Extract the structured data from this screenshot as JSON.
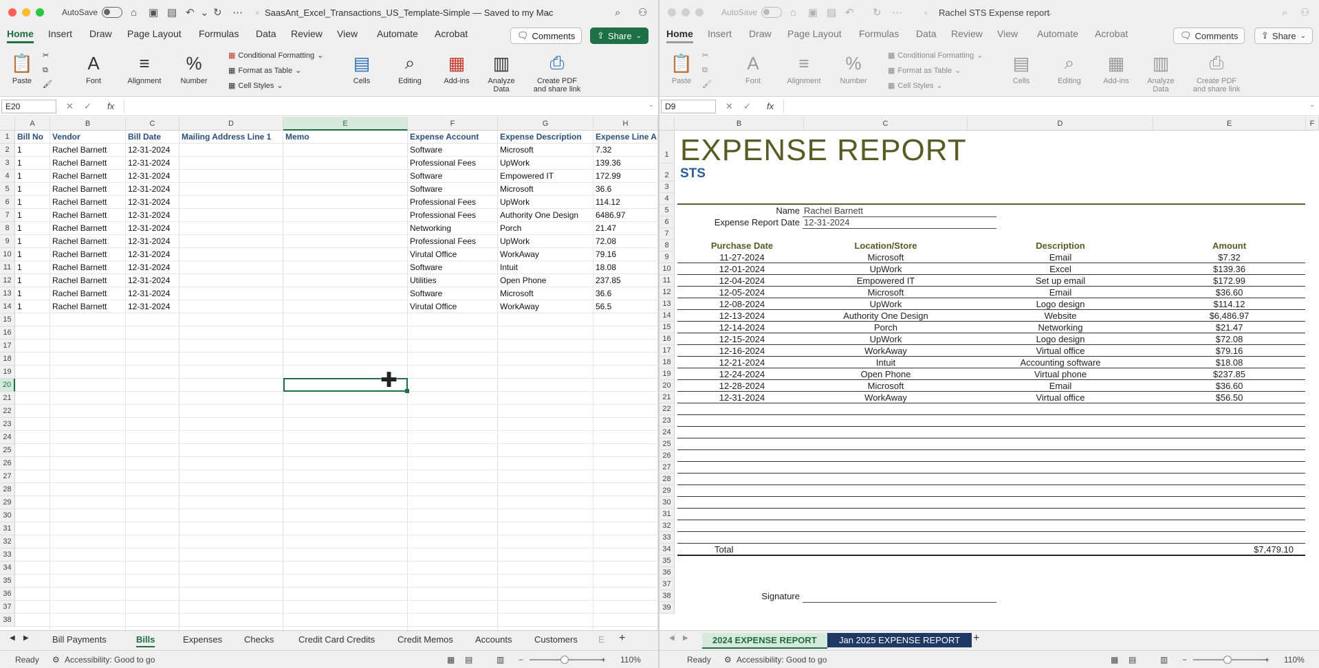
{
  "left": {
    "autosave": "AutoSave",
    "title": "SaasAnt_Excel_Transactions_US_Template-Simple — Saved to my Mac",
    "menu": [
      "Home",
      "Insert",
      "Draw",
      "Page Layout",
      "Formulas",
      "Data",
      "Review",
      "View",
      "Automate",
      "Acrobat"
    ],
    "comments": "Comments",
    "share": "Share",
    "ribbon": {
      "paste": "Paste",
      "font": "Font",
      "alignment": "Alignment",
      "number": "Number",
      "cond_format": "Conditional Formatting",
      "format_table": "Format as Table",
      "cell_styles": "Cell Styles",
      "cells": "Cells",
      "editing": "Editing",
      "addins": "Add-ins",
      "analyze1": "Analyze",
      "analyze2": "Data",
      "pdf1": "Create PDF",
      "pdf2": "and share link"
    },
    "namebox": "E20",
    "columns": [
      "A",
      "B",
      "C",
      "D",
      "E",
      "F",
      "G",
      "H"
    ],
    "headers": [
      "Bill No",
      "Vendor",
      "Bill Date",
      "Mailing Address Line 1",
      "Memo",
      "Expense Account",
      "Expense Description",
      "Expense Line A"
    ],
    "rows": [
      [
        "1",
        "Rachel Barnett",
        "12-31-2024",
        "",
        "",
        "Software",
        "Microsoft",
        "7.32"
      ],
      [
        "1",
        "Rachel Barnett",
        "12-31-2024",
        "",
        "",
        "Professional Fees",
        "UpWork",
        "139.36"
      ],
      [
        "1",
        "Rachel Barnett",
        "12-31-2024",
        "",
        "",
        "Software",
        "Empowered IT",
        "172.99"
      ],
      [
        "1",
        "Rachel Barnett",
        "12-31-2024",
        "",
        "",
        "Software",
        "Microsoft",
        "36.6"
      ],
      [
        "1",
        "Rachel Barnett",
        "12-31-2024",
        "",
        "",
        "Professional Fees",
        "UpWork",
        "114.12"
      ],
      [
        "1",
        "Rachel Barnett",
        "12-31-2024",
        "",
        "",
        "Professional Fees",
        "Authority One Design",
        "6486.97"
      ],
      [
        "1",
        "Rachel Barnett",
        "12-31-2024",
        "",
        "",
        "Networking",
        "Porch",
        "21.47"
      ],
      [
        "1",
        "Rachel Barnett",
        "12-31-2024",
        "",
        "",
        "Professional Fees",
        "UpWork",
        "72.08"
      ],
      [
        "1",
        "Rachel Barnett",
        "12-31-2024",
        "",
        "",
        "Virutal Office",
        "WorkAway",
        "79.16"
      ],
      [
        "1",
        "Rachel Barnett",
        "12-31-2024",
        "",
        "",
        "Software",
        "Intuit",
        "18.08"
      ],
      [
        "1",
        "Rachel Barnett",
        "12-31-2024",
        "",
        "",
        "Utilities",
        "Open Phone",
        "237.85"
      ],
      [
        "1",
        "Rachel Barnett",
        "12-31-2024",
        "",
        "",
        "Software",
        "Microsoft",
        "36.6"
      ],
      [
        "1",
        "Rachel Barnett",
        "12-31-2024",
        "",
        "",
        "Virutal Office",
        "WorkAway",
        "56.5"
      ]
    ],
    "row_numbers": [
      "1",
      "2",
      "3",
      "4",
      "5",
      "6",
      "7",
      "8",
      "9",
      "10",
      "11",
      "12",
      "13",
      "14",
      "15",
      "16",
      "17",
      "18",
      "19",
      "20",
      "21",
      "22",
      "23",
      "24",
      "25",
      "26",
      "27",
      "28",
      "29",
      "30",
      "31",
      "32",
      "33",
      "34",
      "35",
      "36",
      "37",
      "38"
    ],
    "sheets": [
      "Bill Payments",
      "Bills",
      "Expenses",
      "Checks",
      "Credit Card Credits",
      "Credit Memos",
      "Accounts",
      "Customers",
      "E"
    ],
    "status": "Ready",
    "accessibility": "Accessibility: Good to go",
    "zoom": "110%"
  },
  "right": {
    "autosave": "AutoSave",
    "title": "Rachel STS Expense report",
    "menu": [
      "Home",
      "Insert",
      "Draw",
      "Page Layout",
      "Formulas",
      "Data",
      "Review",
      "View",
      "Automate",
      "Acrobat"
    ],
    "comments": "Comments",
    "share": "Share",
    "ribbon": {
      "paste": "Paste",
      "font": "Font",
      "alignment": "Alignment",
      "number": "Number",
      "cond_format": "Conditional Formatting",
      "format_table": "Format as Table",
      "cell_styles": "Cell Styles",
      "cells": "Cells",
      "editing": "Editing",
      "addins": "Add-ins",
      "analyze1": "Analyze",
      "analyze2": "Data",
      "pdf1": "Create PDF",
      "pdf2": "and share link"
    },
    "namebox": "D9",
    "columns": [
      "B",
      "C",
      "D",
      "E",
      "F"
    ],
    "report_title": "EXPENSE REPORT",
    "company": "STS",
    "name_label": "Name",
    "name_value": "Rachel Barnett",
    "date_label": "Expense Report Date",
    "date_value": "12-31-2024",
    "table_headers": [
      "Purchase Date",
      "Location/Store",
      "Description",
      "Amount"
    ],
    "entries": [
      [
        "11-27-2024",
        "Microsoft",
        "Email",
        "$7.32"
      ],
      [
        "12-01-2024",
        "UpWork",
        "Excel",
        "$139.36"
      ],
      [
        "12-04-2024",
        "Empowered IT",
        "Set up email",
        "$172.99"
      ],
      [
        "12-05-2024",
        "Microsoft",
        "Email",
        "$36.60"
      ],
      [
        "12-08-2024",
        "UpWork",
        "Logo design",
        "$114.12"
      ],
      [
        "12-13-2024",
        "Authority One Design",
        "Website",
        "$6,486.97"
      ],
      [
        "12-14-2024",
        "Porch",
        "Networking",
        "$21.47"
      ],
      [
        "12-15-2024",
        "UpWork",
        "Logo design",
        "$72.08"
      ],
      [
        "12-16-2024",
        "WorkAway",
        "Virtual office",
        "$79.16"
      ],
      [
        "12-21-2024",
        "Intuit",
        "Accounting software",
        "$18.08"
      ],
      [
        "12-24-2024",
        "Open Phone",
        "Virtual phone",
        "$237.85"
      ],
      [
        "12-28-2024",
        "Microsoft",
        "Email",
        "$36.60"
      ],
      [
        "12-31-2024",
        "WorkAway",
        "Virtual office",
        "$56.50"
      ]
    ],
    "row_numbers": [
      "1",
      "2",
      "3",
      "4",
      "5",
      "6",
      "7",
      "8",
      "9",
      "10",
      "11",
      "12",
      "13",
      "14",
      "15",
      "16",
      "17",
      "18",
      "19",
      "20",
      "21",
      "22",
      "23",
      "24",
      "25",
      "26",
      "27",
      "28",
      "29",
      "30",
      "31",
      "32",
      "33",
      "34",
      "35",
      "36",
      "37",
      "38",
      "39"
    ],
    "total_label": "Total",
    "total_value": "$7,479.10",
    "signature_label": "Signature",
    "sheets": [
      "2024 EXPENSE REPORT",
      "Jan 2025 EXPENSE REPORT"
    ],
    "status": "Ready",
    "accessibility": "Accessibility: Good to go",
    "zoom": "110%"
  },
  "colors": {
    "excel_green": "#1e7145",
    "header_blue": "#2a4d7a",
    "report_olive": "#5a5a25"
  }
}
